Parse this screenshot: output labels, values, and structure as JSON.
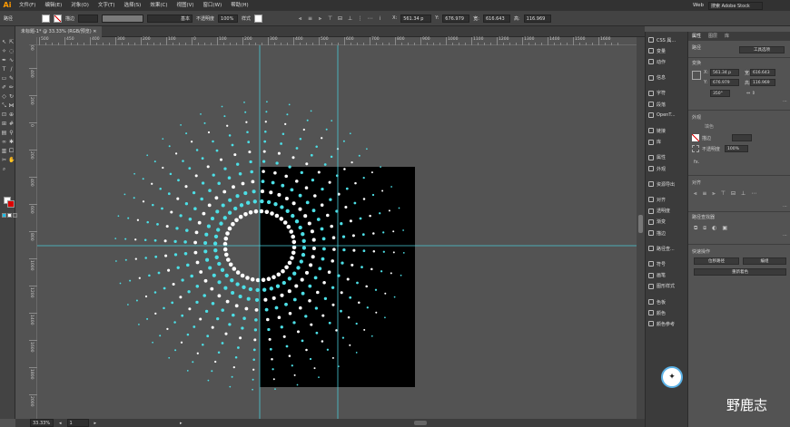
{
  "app": {
    "logo": "Ai",
    "workspace": "Web",
    "search_placeholder": "搜索 Adobe Stock"
  },
  "menu": [
    "文件(F)",
    "编辑(E)",
    "对象(O)",
    "文字(T)",
    "选择(S)",
    "效果(C)",
    "视图(V)",
    "窗口(W)",
    "帮助(H)"
  ],
  "options": {
    "mode": "路径",
    "stroke_label": "描边",
    "brush": "基本",
    "opacity_label": "不透明度",
    "opacity": "100%",
    "style_label": "样式",
    "x": "561.34 p",
    "y": "676.979",
    "w": "616.643",
    "h": "116.969"
  },
  "doc": {
    "tab": "未标题-1* @ 33.33% (RGB/预览)",
    "zoom": "33.33%",
    "page": "1"
  },
  "ruler": {
    "h": [
      "500",
      "450",
      "400",
      "300",
      "200",
      "100",
      "0",
      "100",
      "200",
      "300",
      "400",
      "500",
      "600",
      "700",
      "800",
      "900",
      "1000",
      "1100",
      "1200",
      "1300",
      "1400",
      "1500",
      "1600"
    ],
    "v": [
      "500",
      "400",
      "200",
      "0",
      "200",
      "400",
      "600",
      "800",
      "1000",
      "1200",
      "1400",
      "1600",
      "1800",
      "2000"
    ]
  },
  "dock": [
    "CSS 属...",
    "变量",
    "动作",
    "信息",
    "字符",
    "段落",
    "OpenT...",
    "链接",
    "库",
    "属性",
    "外观",
    "资源导出",
    "对齐",
    "透明度",
    "渐变",
    "描边",
    "路径查...",
    "符号",
    "画笔",
    "图形样式",
    "色板",
    "颜色",
    "颜色参考"
  ],
  "properties": {
    "tabs": [
      "属性",
      "图层",
      "库"
    ],
    "section_path": "路径",
    "toolbar_btn": "工具选项",
    "transform": "变换",
    "x": "561.34 p",
    "y": "676.979",
    "w": "616.643",
    "h": "116.969",
    "angle": "350°",
    "appearance": "外观",
    "fill": "填色",
    "stroke": "描边",
    "opacity_label": "不透明度",
    "opacity": "100%",
    "fx": "fx.",
    "align": "对齐",
    "pathfinder": "路径查找器",
    "quick_actions": "快速操作",
    "btn_offset": "位移路径",
    "btn_group": "编组",
    "btn_recolor": "重新着色"
  },
  "watermark": "野鹿志",
  "colors": {
    "accent": "#4cdfe6",
    "guide": "#49c9d6",
    "artboard": "#000000",
    "canvas": "#535353"
  }
}
